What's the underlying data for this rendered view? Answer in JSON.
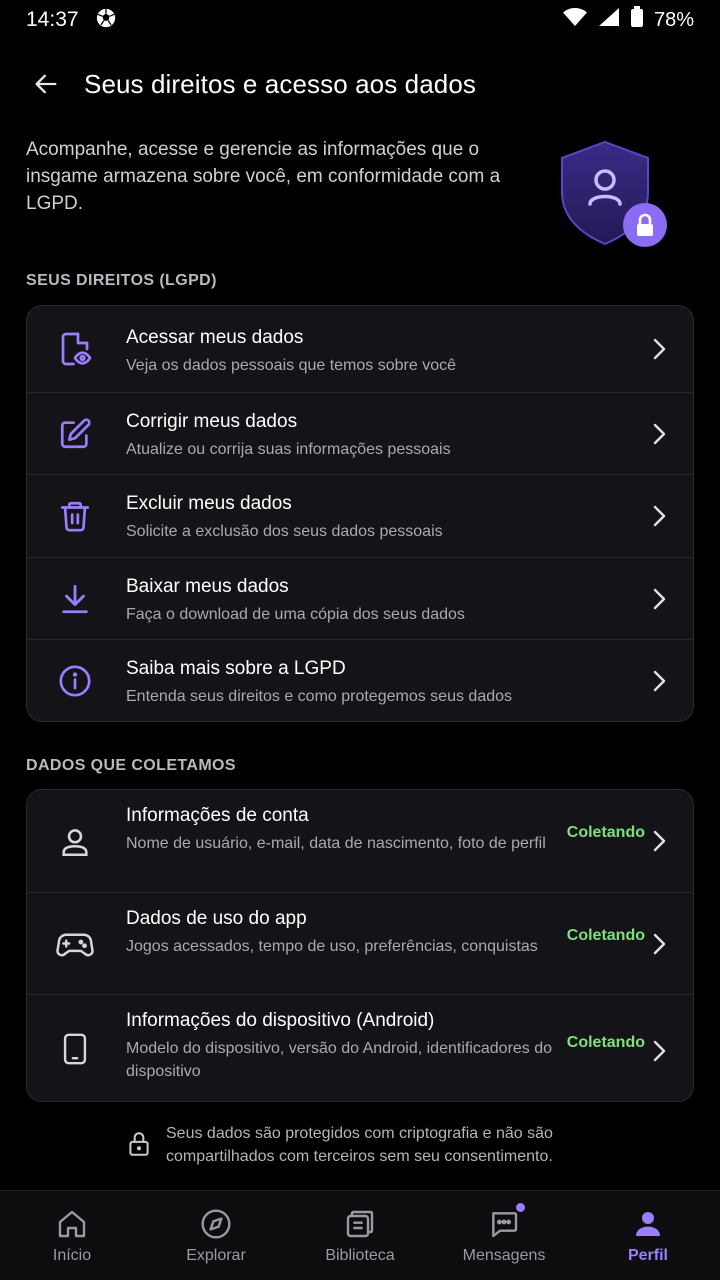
{
  "status": {
    "time": "14:37",
    "battery": "78%"
  },
  "header": {
    "title": "Seus direitos e acesso aos dados"
  },
  "intro": "Acompanhe, acesse e gerencie as informações que o insgame armazena sobre você, em conformidade com a LGPD.",
  "rights_section": {
    "label": "SEUS DIREITOS (LGPD)",
    "items": [
      {
        "title": "Acessar meus dados",
        "subtitle": "Veja os dados pessoais que temos sobre você",
        "icon": "document-eye-icon"
      },
      {
        "title": "Corrigir meus dados",
        "subtitle": "Atualize ou corrija suas informações pessoais",
        "icon": "edit-icon"
      },
      {
        "title": "Excluir meus dados",
        "subtitle": "Solicite a exclusão dos seus dados pessoais",
        "icon": "trash-icon"
      },
      {
        "title": "Baixar meus dados",
        "subtitle": "Faça o download de uma cópia dos seus dados",
        "icon": "download-icon"
      },
      {
        "title": "Saiba mais sobre a LGPD",
        "subtitle": "Entenda seus direitos e como protegemos seus dados",
        "icon": "info-icon"
      }
    ]
  },
  "data_section": {
    "label": "DADOS QUE COLETAMOS",
    "items": [
      {
        "title": "Informações de conta",
        "subtitle": "Nome de usuário, e-mail, data de nascimento, foto de perfil",
        "status": "Coletando",
        "icon": "user-icon"
      },
      {
        "title": "Dados de uso do app",
        "subtitle": "Jogos acessados, tempo de uso, preferências, conquistas",
        "status": "Coletando",
        "icon": "gamepad-icon"
      },
      {
        "title": "Informações do dispositivo (Android)",
        "subtitle": "Modelo do dispositivo, versão do Android, identificadores do dispositivo",
        "status": "Coletando",
        "icon": "tablet-icon"
      }
    ]
  },
  "footer_note": "Seus dados são protegidos com criptografia e não são compartilhados com terceiros sem seu consentimento.",
  "nav": {
    "items": [
      {
        "label": "Início",
        "icon": "home-icon"
      },
      {
        "label": "Explorar",
        "icon": "compass-icon"
      },
      {
        "label": "Biblioteca",
        "icon": "library-icon"
      },
      {
        "label": "Mensagens",
        "icon": "chat-icon"
      },
      {
        "label": "Perfil",
        "icon": "profile-icon"
      }
    ],
    "active": "Perfil"
  },
  "colors": {
    "accent": "#9b7dff",
    "status_green": "#7ee07a",
    "background": "#000000",
    "card": "#141418"
  }
}
